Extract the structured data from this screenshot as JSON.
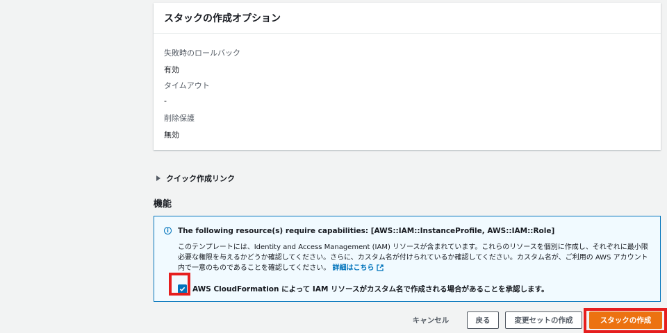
{
  "options_panel": {
    "title": "スタックの作成オプション",
    "properties": [
      {
        "label": "失敗時のロールバック",
        "value": "有効"
      },
      {
        "label": "タイムアウト",
        "value": "-"
      },
      {
        "label": "削除保護",
        "value": "無効"
      }
    ]
  },
  "quick_link": {
    "label": "クイック作成リンク"
  },
  "capabilities": {
    "title": "機能",
    "heading": "The following resource(s) require capabilities: [AWS::IAM::InstanceProfile, AWS::IAM::Role]",
    "body": "このテンプレートには、Identity and Access Management (IAM) リソースが含まれています。これらのリソースを個別に作成し、それぞれに最小限必要な権限を与えるかどうか確認してください。さらに、カスタム名が付けられているか確認してください。カスタム名が、ご利用の AWS アカウント内で一意のものであることを確認してください。",
    "link": "詳細はこちら",
    "ack_label": "AWS CloudFormation によって IAM リソースがカスタム名で作成される場合があることを承認します。",
    "ack_checked": true
  },
  "footer": {
    "cancel": "キャンセル",
    "back": "戻る",
    "create_changeset": "変更セットの作成",
    "create_stack": "スタックの作成"
  },
  "colors": {
    "primary": "#ec7211",
    "info_blue": "#0073bb",
    "highlight_red": "#e61e1e"
  }
}
